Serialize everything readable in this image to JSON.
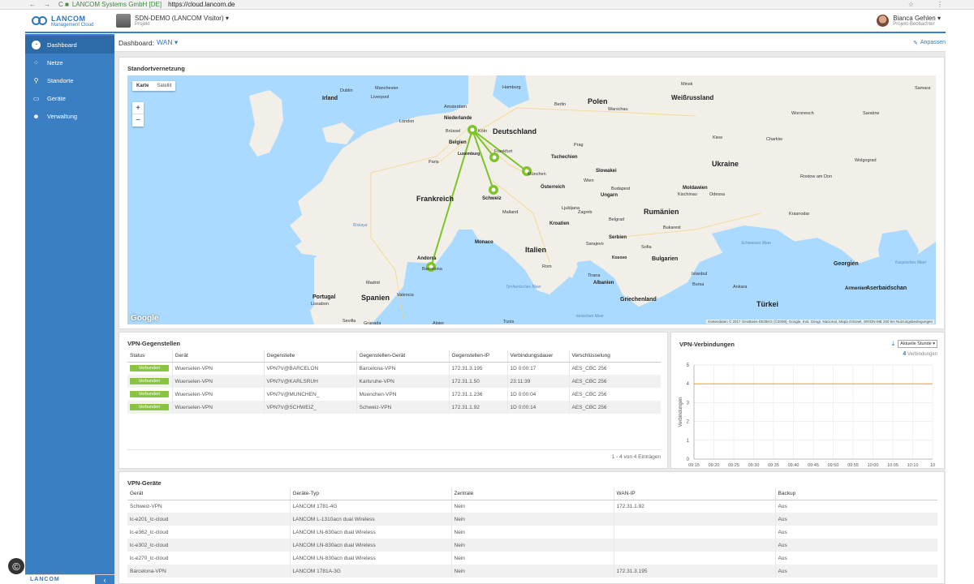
{
  "browser": {
    "site_label": "LANCOM Systems GmbH [DE]",
    "url": "https://cloud.lancom.de"
  },
  "header": {
    "logo_line1": "LANCOM",
    "logo_line2": "Management Cloud",
    "project_name": "SDN-DEMO (LANCOM Visitor)",
    "project_sub": "Projekt",
    "user_name": "Bianca Gehlen",
    "user_role": "Projekt-Beobachter"
  },
  "sidebar": {
    "items": [
      {
        "label": "Dashboard",
        "icon": "dashboard-icon"
      },
      {
        "label": "Netze",
        "icon": "network-icon"
      },
      {
        "label": "Standorte",
        "icon": "location-pin-icon"
      },
      {
        "label": "Geräte",
        "icon": "device-icon"
      },
      {
        "label": "Verwaltung",
        "icon": "users-icon"
      }
    ],
    "bottom_logo": "LANCOM"
  },
  "dashboard": {
    "label": "Dashboard:",
    "selection": "WAN",
    "edit_label": "Anpassen"
  },
  "map": {
    "title": "Standortvernetzung",
    "tab_map": "Karte",
    "tab_satellite": "Satellit",
    "zoom_in": "+",
    "zoom_out": "−",
    "google": "Google",
    "attribution": "Kartendaten © 2017 GeoBasis-DE/BKG (©2009), Google, Inst. Geogr. Nacional, Mapa GISrael, ORION-ME   200 km   Nutzungsbedingungen",
    "countries": [
      "Irland",
      "Polen",
      "Weißrussland",
      "Deutschland",
      "Frankreich",
      "Ukraine",
      "Spanien",
      "Italien",
      "Rumänien",
      "Türkei",
      "Portugal",
      "Österreich",
      "Schweiz",
      "Tschechien",
      "Slowakei",
      "Ungarn",
      "Bulgarien",
      "Griechenland",
      "Niederlande",
      "Belgien",
      "Kroatien",
      "Serbien",
      "Moldawien",
      "Georgien",
      "Aserbaidschan",
      "Armenien",
      "Albanien",
      "Monaco",
      "Andorra",
      "Luxemburg",
      "Kosovo"
    ],
    "cities": [
      "Dublin",
      "Liverpool",
      "Manchester",
      "London",
      "Amsterdam",
      "Hamburg",
      "Berlin",
      "Warschau",
      "Minsk",
      "Köln",
      "Brüssel",
      "Frankfurt",
      "Paris",
      "Prag",
      "Kiew",
      "München",
      "Wien",
      "Bukarest",
      "Mailand",
      "Rom",
      "Madrid",
      "Lissabon",
      "Valencia",
      "Barcelona",
      "Sevilla",
      "Algier",
      "Tunis",
      "Istanbul",
      "Ankara",
      "Sofia",
      "Belgrad",
      "Sarajevo",
      "Tirana",
      "Odessa",
      "Rostow am Don",
      "Wolgograd",
      "Samara",
      "Saratow",
      "Woronesch",
      "Charkiw",
      "Krasnodar",
      "Kischinau",
      "Budapest",
      "Granada",
      "Bursa",
      "Ljubljana",
      "Zagreb"
    ],
    "seas": [
      "Schwarzes Meer",
      "Tyrrhenisches Meer",
      "Ionisches Meer",
      "Kaspisches Meer",
      "Biskaya"
    ]
  },
  "vpn_peers": {
    "title": "VPN-Gegenstellen",
    "columns": [
      "Status",
      "Gerät",
      "Gegenstelle",
      "Gegenstellen-Gerät",
      "Gegenstellen-IP",
      "Verbindungsdauer",
      "Verschlüsselung"
    ],
    "rows": [
      {
        "status": "Verbunden",
        "device": "Wuerselen-VPN",
        "peer": "VPN?V@BARCELON",
        "peer_device": "Barcelona-VPN",
        "ip": "172.31.3.195",
        "duration": "1D 0:00:17",
        "encryption": "AES_CBC 256"
      },
      {
        "status": "Verbunden",
        "device": "Wuerselen-VPN",
        "peer": "VPN?V@KARLSRUH",
        "peer_device": "Karlsruhe-VPN",
        "ip": "172.31.1.50",
        "duration": "23:11:39",
        "encryption": "AES_CBC 256"
      },
      {
        "status": "Verbunden",
        "device": "Wuerselen-VPN",
        "peer": "VPN?V@MUNCHEN_",
        "peer_device": "Muenchen-VPN",
        "ip": "172.31.1.236",
        "duration": "1D 0:00:04",
        "encryption": "AES_CBC 256"
      },
      {
        "status": "Verbunden",
        "device": "Wuerselen-VPN",
        "peer": "VPN?V@SCHWEIZ_",
        "peer_device": "Schweiz-VPN",
        "ip": "172.31.1.92",
        "duration": "1D 0:00:14",
        "encryption": "AES_CBC 256"
      }
    ],
    "pager": "1 - 4 von 4 Einträgen"
  },
  "vpn_connections": {
    "title": "VPN-Verbindungen",
    "range_select": "Aktuelle Stunde",
    "count_value": "4",
    "count_label": "Verbindungen"
  },
  "chart_data": {
    "type": "line",
    "title": "VPN-Verbindungen",
    "ylabel": "Verbindungen",
    "xlabel": "",
    "ylim": [
      0,
      5
    ],
    "yticks": [
      0,
      1,
      2,
      3,
      4,
      5
    ],
    "xticks": [
      "09:15",
      "09:20",
      "09:25",
      "09:30",
      "09:35",
      "09:40",
      "09:45",
      "09:50",
      "09:55",
      "10:00",
      "10:05",
      "10:10",
      "10"
    ],
    "series": [
      {
        "values": [
          4,
          4,
          4,
          4,
          4,
          4,
          4,
          4,
          4,
          4,
          4,
          4,
          4
        ],
        "color": "#f0a830"
      }
    ],
    "grid": true
  },
  "vpn_devices": {
    "title": "VPN-Geräte",
    "columns": [
      "Gerät",
      "Geräte-Typ",
      "Zentrale",
      "WAN-IP",
      "Backup"
    ],
    "rows": [
      {
        "device": "Schweiz-VPN",
        "type": "LANCOM 1781-4G",
        "central": "Nein",
        "wan_ip": "172.31.1.92",
        "backup": "Aus"
      },
      {
        "device": "lc-e201_lc-cloud",
        "type": "LANCOM L-1310acn dual Wireless",
        "central": "Nein",
        "wan_ip": "",
        "backup": "Aus"
      },
      {
        "device": "lc-e362_lc-cloud",
        "type": "LANCOM LN-630acn dual Wireless",
        "central": "Nein",
        "wan_ip": "",
        "backup": "Aus"
      },
      {
        "device": "lc-e302_lc-cloud",
        "type": "LANCOM LN-830acn dual Wireless",
        "central": "Nein",
        "wan_ip": "",
        "backup": "Aus"
      },
      {
        "device": "lc-e270_lc-cloud",
        "type": "LANCOM LN-830acn dual Wireless",
        "central": "Nein",
        "wan_ip": "",
        "backup": "Aus"
      },
      {
        "device": "Barcelona-VPN",
        "type": "LANCOM 1781A-3G",
        "central": "Nein",
        "wan_ip": "172.31.3.195",
        "backup": "Aus"
      }
    ]
  },
  "colors": {
    "brand": "#3a7fc4",
    "status_green": "#8cc43c",
    "vpn_line": "#7dc42a",
    "chart_line": "#f0a830"
  }
}
